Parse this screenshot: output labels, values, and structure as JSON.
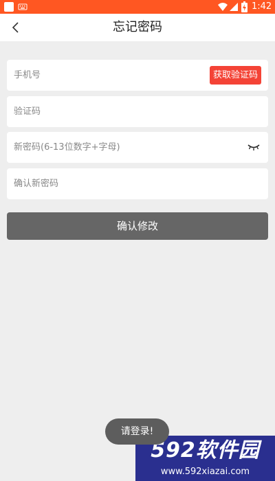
{
  "status_bar": {
    "time": "1:42",
    "icons": [
      "app-icon",
      "keyboard-icon",
      "wifi-icon",
      "signal-icon",
      "battery-icon"
    ],
    "color": "#ff5722"
  },
  "header": {
    "back_icon": "chevron-left-icon",
    "title": "忘记密码"
  },
  "form": {
    "phone_placeholder": "手机号",
    "get_code_label": "获取验证码",
    "code_placeholder": "验证码",
    "new_password_placeholder": "新密码(6-13位数字+字母)",
    "eye_icon": "eye-closed-icon",
    "confirm_password_placeholder": "确认新密码",
    "submit_label": "确认修改"
  },
  "toast": {
    "text": "请登录!"
  },
  "watermark": {
    "logo": "592软件园",
    "url": "www.592xiazai.com"
  },
  "colors": {
    "accent": "#f44336",
    "button": "#666666",
    "background": "#eeeeee"
  }
}
